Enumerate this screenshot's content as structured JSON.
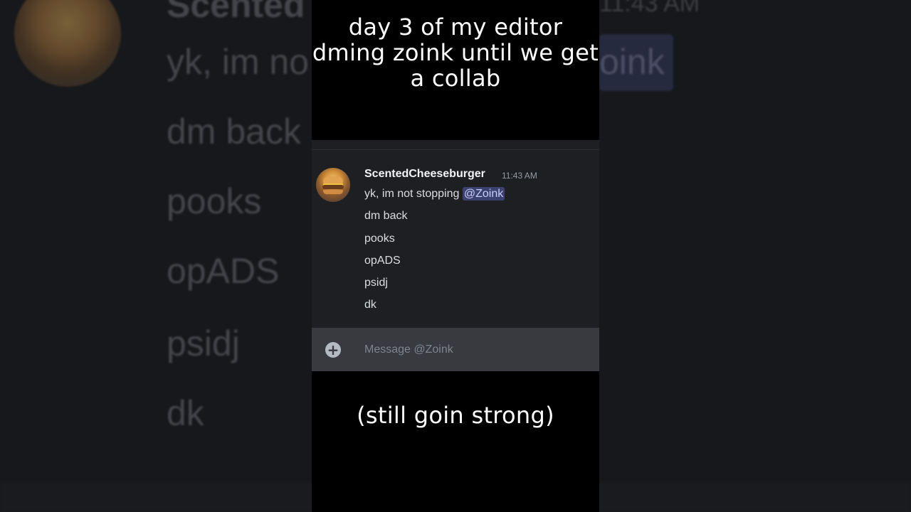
{
  "background": {
    "username": "Scented",
    "timestamp": "11:43 AM",
    "mention": "oink",
    "lines": [
      "yk, im no",
      "dm back",
      "pooks",
      "opADS",
      "psidj",
      "dk"
    ]
  },
  "captions": {
    "top": "day 3 of my editor dming zoink until we get a collab",
    "bottom": "(still goin strong)"
  },
  "chat": {
    "username": "ScentedCheeseburger",
    "timestamp": "11:43 AM",
    "first_message_text": "yk, im not stopping ",
    "mention": "@Zoink",
    "messages": [
      "dm back",
      "pooks",
      "opADS",
      "psidj",
      "dk"
    ]
  },
  "composer": {
    "placeholder": "Message @Zoink",
    "add_icon": "plus-circle-icon"
  },
  "colors": {
    "chat_bg": "#1e1f22",
    "composer_bg": "#383a40",
    "mention_bg": "#3c4270",
    "mention_text": "#c9cdfb"
  }
}
